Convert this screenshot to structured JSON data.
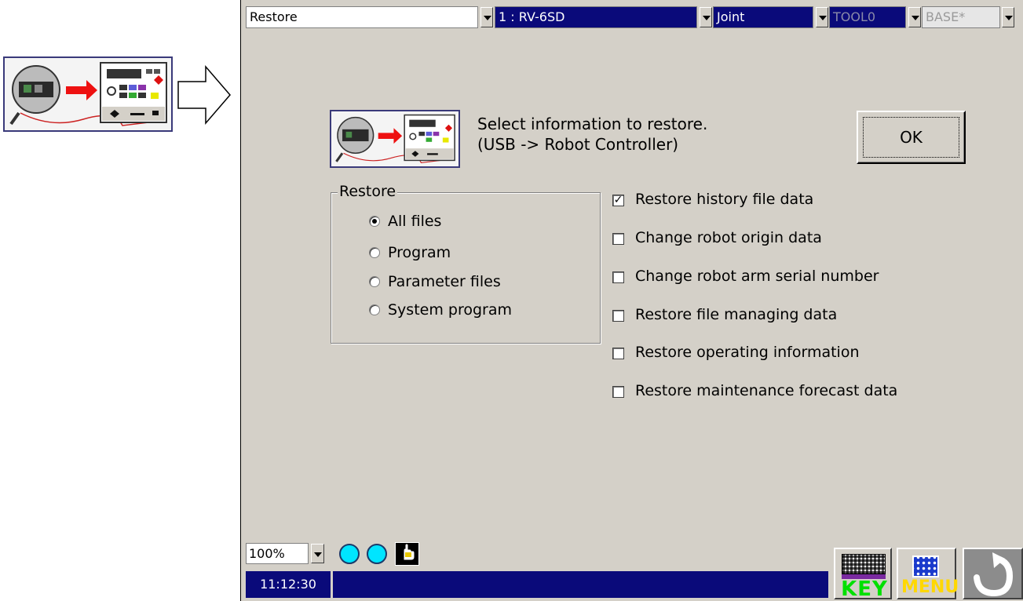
{
  "topbar": {
    "mode": "Restore",
    "robot": "1 : RV-6SD",
    "jog_mode": "Joint",
    "tool": "TOOL0",
    "base": "BASE*"
  },
  "header": {
    "line1": "Select information to restore.",
    "line2": "(USB -> Robot Controller)",
    "ok_label": "OK"
  },
  "restore_group": {
    "title": "Restore",
    "options": [
      {
        "label": "All files",
        "selected": true
      },
      {
        "label": "Program",
        "selected": false
      },
      {
        "label": "Parameter files",
        "selected": false
      },
      {
        "label": "System program",
        "selected": false
      }
    ]
  },
  "checkboxes": [
    {
      "label": "Restore history file data",
      "checked": true
    },
    {
      "label": "Change robot origin data",
      "checked": false
    },
    {
      "label": "Change robot arm serial number",
      "checked": false
    },
    {
      "label": "Restore file managing data",
      "checked": false
    },
    {
      "label": "Restore operating information",
      "checked": false
    },
    {
      "label": "Restore maintenance forecast data",
      "checked": false
    }
  ],
  "footer": {
    "zoom": "100%",
    "time": "11:12:30",
    "key_label": "KEY",
    "menu_label": "MENU"
  },
  "icons": {
    "status_led": "cyan-circle",
    "hand": "hand-icon",
    "back": "return-arrow-icon"
  },
  "colors": {
    "screen_bg": "#d4d0c8",
    "titlebar_blue": "#0a0a7a",
    "led": "#00e5ff"
  }
}
